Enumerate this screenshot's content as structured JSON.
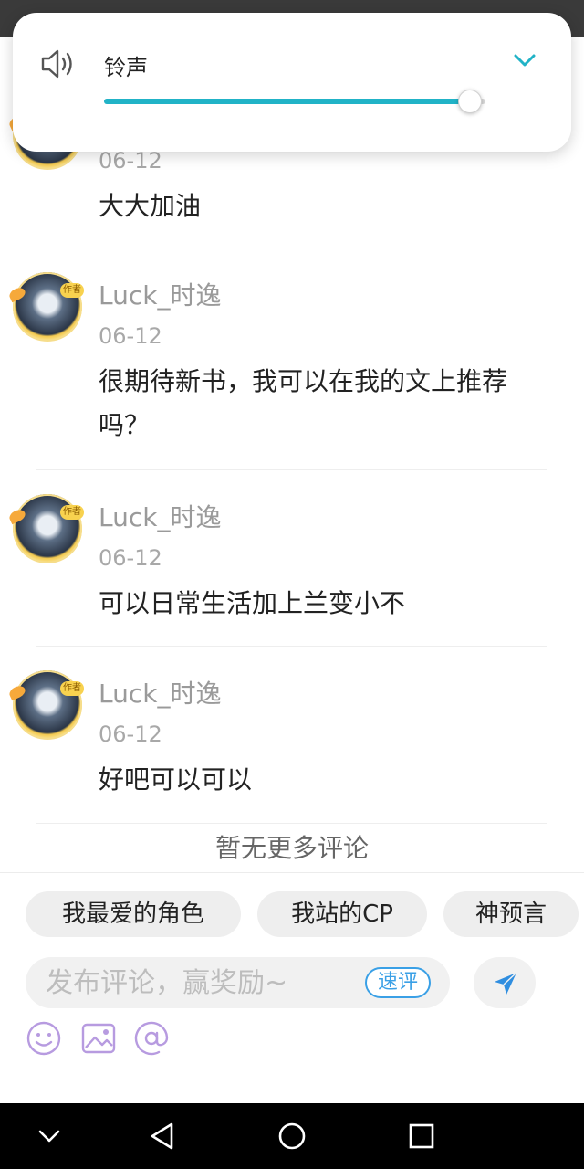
{
  "volume_panel": {
    "label": "铃声",
    "level": 0.96,
    "accent_color": "#21b3c7",
    "icon": "speaker-icon",
    "expand_icon": "chevron-down-icon"
  },
  "comments": [
    {
      "username": "",
      "date": "06-12",
      "text": "大大加油"
    },
    {
      "username": "Luck_时逸",
      "date": "06-12",
      "text": "很期待新书，我可以在我的文上推荐吗？"
    },
    {
      "username": "Luck_时逸",
      "date": "06-12",
      "text": "可以日常生活加上兰变小不"
    },
    {
      "username": "Luck_时逸",
      "date": "06-12",
      "text": "好吧可以可以"
    }
  ],
  "avatar_badge": "作者",
  "no_more_text": "暂无更多评论",
  "chips": [
    "我最爱的角色",
    "我站的CP",
    "神预言"
  ],
  "comment_input": {
    "placeholder": "发布评论，赢奖励~",
    "quick_label": "速评",
    "send_icon": "send-icon"
  },
  "tools": [
    "emoji-icon",
    "image-icon",
    "mention-icon"
  ],
  "tool_color": "#b79be0",
  "nav": [
    "back-chevron-icon",
    "back-triangle-icon",
    "home-circle-icon",
    "recents-square-icon"
  ]
}
